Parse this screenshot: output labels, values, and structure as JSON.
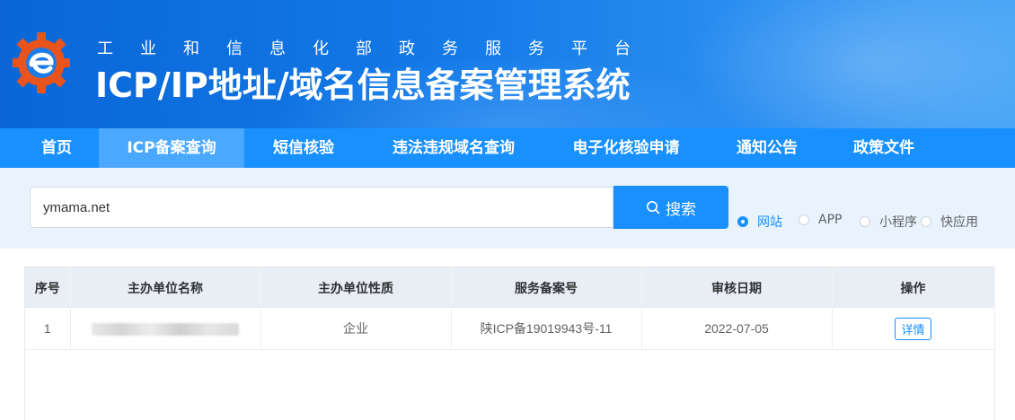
{
  "header": {
    "subtitle": "工业和信息化部政务服务平台",
    "title": "ICP/IP地址/域名信息备案管理系统",
    "logo_icon": "ministry-gear-e-logo"
  },
  "nav": {
    "items": [
      {
        "label": "首页"
      },
      {
        "label": "ICP备案查询",
        "active": true
      },
      {
        "label": "短信核验"
      },
      {
        "label": "违法违规域名查询"
      },
      {
        "label": "电子化核验申请"
      },
      {
        "label": "通知公告"
      },
      {
        "label": "政策文件"
      }
    ]
  },
  "search": {
    "value": "ymama.net",
    "button_label": "搜索",
    "button_icon": "search-icon",
    "types": [
      {
        "label": "网站",
        "checked": true
      },
      {
        "label": "APP"
      },
      {
        "label": "小程序"
      },
      {
        "label": "快应用"
      }
    ]
  },
  "table": {
    "headers": [
      "序号",
      "主办单位名称",
      "主办单位性质",
      "服务备案号",
      "审核日期",
      "操作"
    ],
    "rows": [
      {
        "index": "1",
        "org_name": "",
        "org_type": "企业",
        "record_no": "陕ICP备19019943号-11",
        "date": "2022-07-05",
        "action": "详情"
      }
    ]
  },
  "colors": {
    "primary": "#1890ff",
    "nav_active": "#4aa8ff",
    "search_band": "#e8f3fd",
    "table_header": "#e9eef5"
  }
}
